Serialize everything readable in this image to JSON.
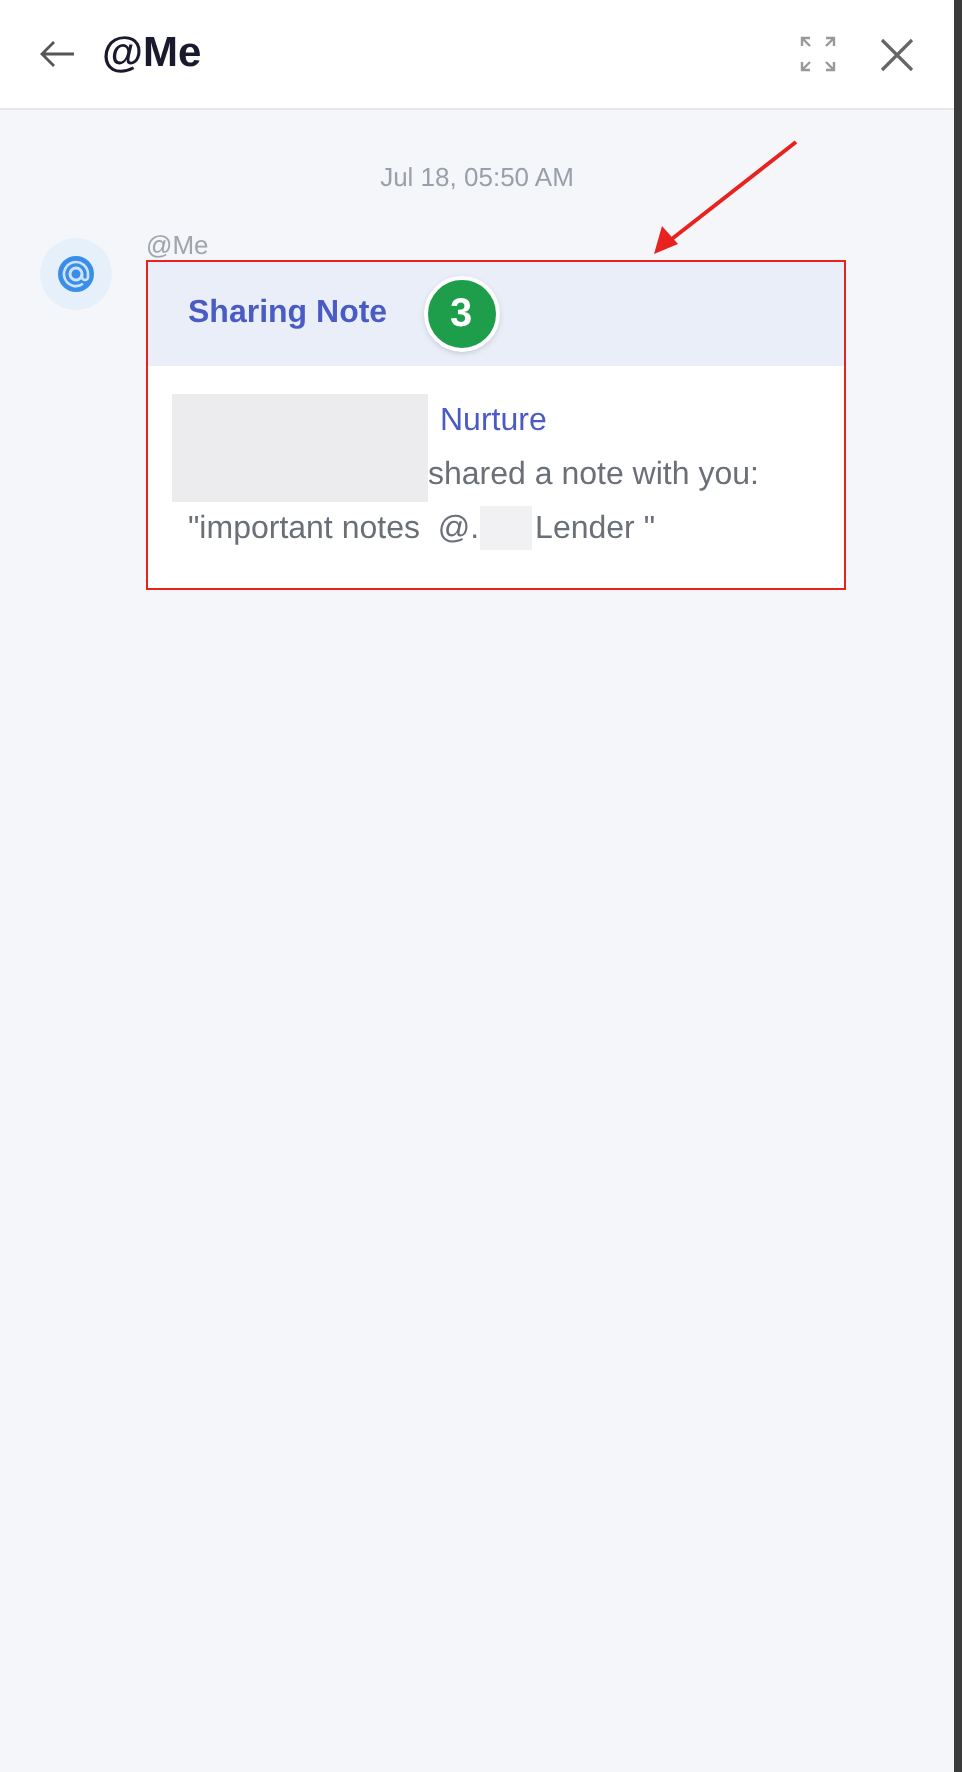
{
  "header": {
    "title": "@Me"
  },
  "timestamp": "Jul 18, 05:50 AM",
  "message": {
    "sender": "@Me",
    "card": {
      "title": "Sharing Note",
      "line_1": "Nurture",
      "line_2": "shared a note with you:",
      "line_3_start": "\"important notes  @.",
      "line_3_end": "Lender \""
    }
  },
  "annotations": [
    {
      "kind": "arrow",
      "color": "#e8221e"
    },
    {
      "kind": "outline",
      "color": "#e8221e"
    },
    {
      "kind": "badge",
      "label": "3",
      "color": "#1e9e4a"
    }
  ]
}
